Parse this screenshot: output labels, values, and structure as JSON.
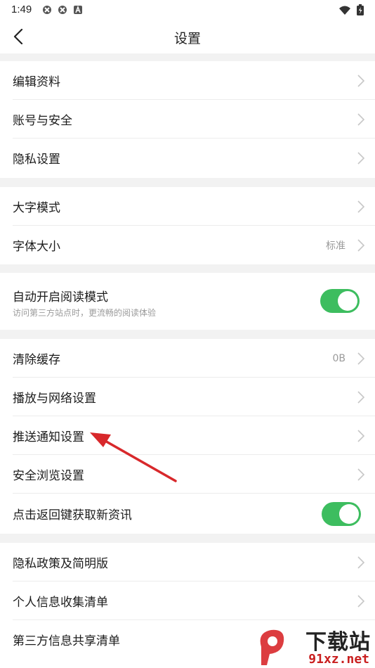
{
  "status": {
    "time": "1:49"
  },
  "header": {
    "title": "设置"
  },
  "groups": {
    "account": [
      "编辑资料",
      "账号与安全",
      "隐私设置"
    ],
    "display": {
      "large_text": "大字模式",
      "font_size": "字体大小",
      "font_size_value": "标准"
    },
    "reading": {
      "label": "自动开启阅读模式",
      "sublabel": "访问第三方站点时，更流畅的阅读体验",
      "enabled": true
    },
    "general": {
      "clear_cache": "清除缓存",
      "cache_value": "0B",
      "playback": "播放与网络设置",
      "push": "推送通知设置",
      "safe_browse": "安全浏览设置",
      "back_refresh": "点击返回键获取新资讯",
      "back_refresh_enabled": true
    },
    "privacy": [
      "隐私政策及简明版",
      "个人信息收集清单",
      "第三方信息共享清单"
    ]
  },
  "watermark": {
    "text": "下载站",
    "domain": "91xz.net"
  },
  "colors": {
    "toggle_on": "#3dbd5f",
    "annotation_arrow": "#d8282b"
  }
}
